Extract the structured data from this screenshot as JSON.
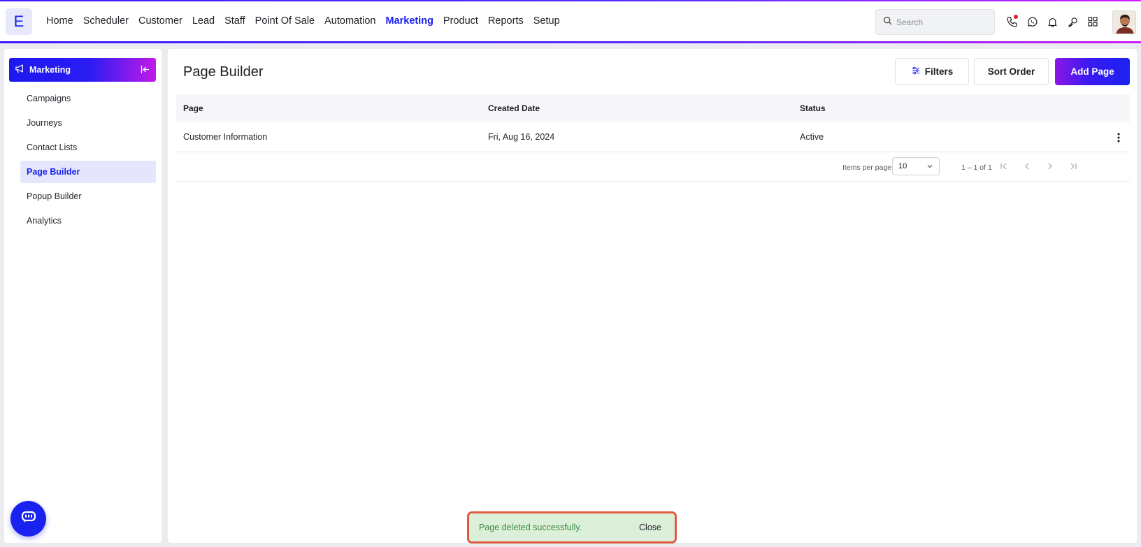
{
  "app": {
    "logo_letter": "E"
  },
  "nav": {
    "items": [
      {
        "label": "Home"
      },
      {
        "label": "Scheduler"
      },
      {
        "label": "Customer"
      },
      {
        "label": "Lead"
      },
      {
        "label": "Staff"
      },
      {
        "label": "Point Of Sale"
      },
      {
        "label": "Automation"
      },
      {
        "label": "Marketing",
        "active": true
      },
      {
        "label": "Product"
      },
      {
        "label": "Reports"
      },
      {
        "label": "Setup"
      }
    ]
  },
  "search": {
    "placeholder": "Search",
    "value": ""
  },
  "top_icons": [
    "phone-icon",
    "whatsapp-icon",
    "bell-icon",
    "key-icon",
    "apps-grid-icon"
  ],
  "sidebar": {
    "header": "Marketing",
    "items": [
      {
        "label": "Campaigns"
      },
      {
        "label": "Journeys"
      },
      {
        "label": "Contact Lists"
      },
      {
        "label": "Page Builder",
        "active": true
      },
      {
        "label": "Popup Builder"
      },
      {
        "label": "Analytics"
      }
    ]
  },
  "main": {
    "title": "Page Builder",
    "buttons": {
      "filters": "Filters",
      "sort": "Sort Order",
      "add": "Add Page"
    },
    "table": {
      "columns": [
        "Page",
        "Created Date",
        "Status"
      ],
      "rows": [
        {
          "page": "Customer Information",
          "created": "Fri, Aug 16, 2024",
          "status": "Active"
        }
      ]
    },
    "paginator": {
      "items_per_page_label": "Items per page:",
      "items_per_page": "10",
      "range": "1 – 1 of 1"
    }
  },
  "snackbar": {
    "message": "Page deleted successfully.",
    "action": "Close"
  },
  "colors": {
    "accent": "#1a22f0",
    "gradient_end": "#c21ae8",
    "snackbar_bg": "#dcefd9",
    "snackbar_text": "#3e8a3e",
    "highlight_border": "#e05a3f"
  }
}
